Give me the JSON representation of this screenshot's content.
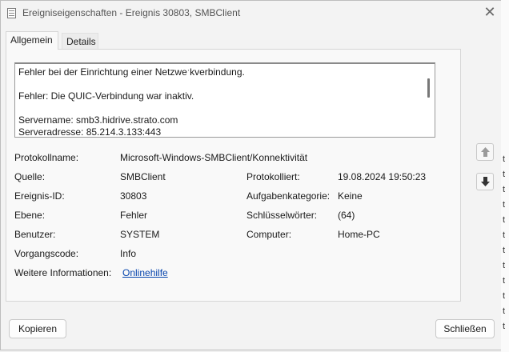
{
  "window": {
    "title": "Ereigniseigenschaften - Ereignis 30803, SMBClient",
    "close_glyph": "✕"
  },
  "tabs": [
    {
      "label": "Allgemein",
      "active": true
    },
    {
      "label": "Details",
      "active": false
    }
  ],
  "description": {
    "lines": [
      "Fehler bei der Einrichtung einer Netzweˑkverbindung.",
      "Fehler: Die QUIC-Verbindung war inaktiv.",
      "Servername: smb3.hidrive.strato.com",
      "Serveradresse: 85.214.3.133:443"
    ]
  },
  "fields": {
    "protokollname": {
      "label": "Protokollname:",
      "value": "Microsoft-Windows-SMBClient/Konnektivität"
    },
    "quelle": {
      "label": "Quelle:",
      "value": "SMBClient"
    },
    "protokolliert": {
      "label": "Protokolliert:",
      "value": "19.08.2024 19:50:23"
    },
    "ereignis_id": {
      "label": "Ereignis-ID:",
      "value": "30803"
    },
    "aufgabenkategorie": {
      "label": "Aufgabenkategorie:",
      "value": "Keine"
    },
    "ebene": {
      "label": "Ebene:",
      "value": "Fehler"
    },
    "schluesselwoerter": {
      "label": "Schlüsselwörter:",
      "value": "(64)"
    },
    "benutzer": {
      "label": "Benutzer:",
      "value": "SYSTEM"
    },
    "computer": {
      "label": "Computer:",
      "value": "Home-PC"
    },
    "vorgangscode": {
      "label": "Vorgangscode:",
      "value": "Info"
    },
    "weitere": {
      "label": "Weitere Informationen:",
      "value": "Onlinehilfe"
    }
  },
  "buttons": {
    "copy": "Kopieren",
    "close": "Schließen"
  },
  "icons": {
    "up": "arrow-up-icon",
    "down": "arrow-down-icon"
  },
  "background_strip": [
    "t",
    "t",
    "t",
    "t",
    "t",
    "t",
    "t",
    "t",
    "t",
    "t",
    "t",
    "t"
  ]
}
